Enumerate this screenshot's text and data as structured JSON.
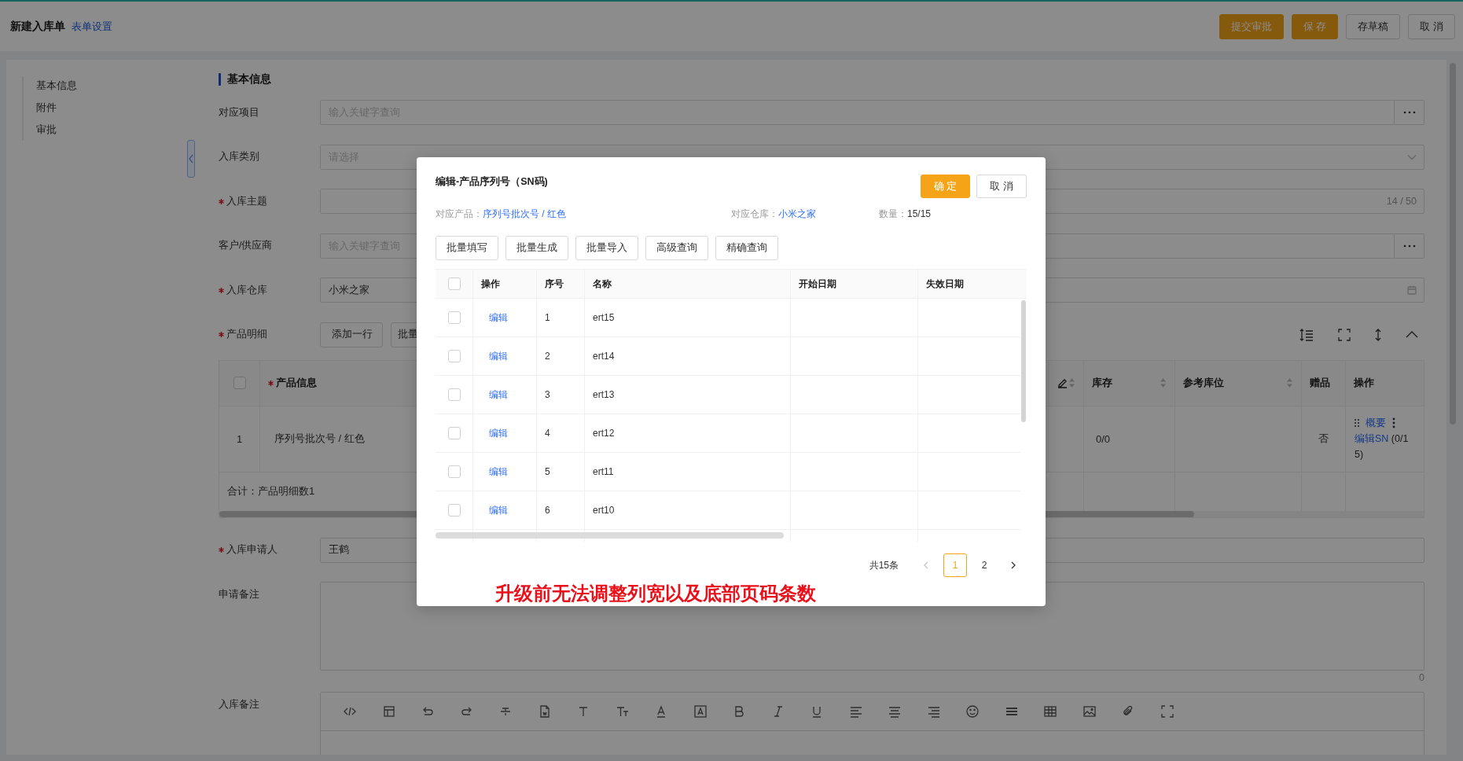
{
  "header": {
    "title": "新建入库单",
    "link": "表单设置",
    "buttons": [
      {
        "label": "提交审批",
        "kind": "primary"
      },
      {
        "label": "保 存",
        "kind": "primary"
      },
      {
        "label": "存草稿",
        "kind": "default"
      },
      {
        "label": "取 消",
        "kind": "default"
      }
    ]
  },
  "anchor_nav": [
    {
      "label": "基本信息"
    },
    {
      "label": "附件"
    },
    {
      "label": "审批"
    }
  ],
  "section_title": "基本信息",
  "form_rows": [
    {
      "label": "对应项目",
      "required": false,
      "kind": "lookup",
      "placeholder": "输入关键字查询"
    },
    {
      "label": "入库类别",
      "required": false,
      "kind": "select",
      "placeholder": "请选择"
    },
    {
      "label": "入库主题",
      "required": true,
      "kind": "counted",
      "counter": "14 / 50"
    },
    {
      "label": "客户/供应商",
      "required": false,
      "kind": "lookup",
      "placeholder": "输入关键字查询"
    },
    {
      "label": "入库仓库",
      "required": true,
      "kind": "date",
      "value": "小米之家"
    },
    {
      "label": "产品明细",
      "required": true,
      "kind": "actions",
      "buttons": [
        "添加一行",
        "批量"
      ]
    }
  ],
  "product_table": {
    "select_all": {
      "checked": false
    },
    "columns": [
      {
        "label": "产品信息",
        "required": true,
        "sortable": false
      },
      {
        "label": "库存",
        "required": false,
        "sortable": true
      },
      {
        "label": "参考库位",
        "required": false,
        "sortable": true
      },
      {
        "label": "赠品",
        "required": false,
        "sortable": false
      },
      {
        "label": "操作",
        "required": false,
        "sortable": false
      }
    ],
    "rows": [
      {
        "index": "1",
        "product": "序列号批次号 / 红色",
        "stock": "0/0",
        "gift": "否",
        "summary_link": "概要",
        "sn_link": "编辑SN",
        "sn_count": "(0/15)"
      }
    ],
    "footer": "合计：产品明细数1"
  },
  "lower_rows": [
    {
      "label": "入库申请人",
      "required": true,
      "kind": "text",
      "value": "王鹤"
    },
    {
      "label": "申请备注",
      "required": false,
      "kind": "textarea",
      "counter": "0"
    },
    {
      "label": "入库备注",
      "required": false,
      "kind": "editor"
    }
  ],
  "modal": {
    "title": "编辑-产品序列号（SN码)",
    "confirm": "确 定",
    "cancel": "取 消",
    "info": [
      {
        "label": "对应产品：",
        "value": "序列号批次号 / 红色",
        "kind": "link"
      },
      {
        "label": "对应仓库：",
        "value": "小米之家",
        "kind": "link"
      },
      {
        "label": "数量：",
        "value": "15/15",
        "kind": "plain"
      }
    ],
    "tools": [
      "批量填写",
      "批量生成",
      "批量导入",
      "高级查询",
      "精确查询"
    ],
    "select_all": {
      "checked": false
    },
    "columns": [
      "操作",
      "序号",
      "名称",
      "开始日期",
      "失效日期"
    ],
    "rows": [
      {
        "checked": false,
        "action": "编辑",
        "index": "1",
        "name": "ert15"
      },
      {
        "checked": false,
        "action": "编辑",
        "index": "2",
        "name": "ert14"
      },
      {
        "checked": false,
        "action": "编辑",
        "index": "3",
        "name": "ert13"
      },
      {
        "checked": false,
        "action": "编辑",
        "index": "4",
        "name": "ert12"
      },
      {
        "checked": false,
        "action": "编辑",
        "index": "5",
        "name": "ert11"
      },
      {
        "checked": false,
        "action": "编辑",
        "index": "6",
        "name": "ert10"
      }
    ],
    "pagination": {
      "total": "共15条",
      "prev_disabled": true,
      "next_disabled": false,
      "pages": [
        {
          "label": "1",
          "selected": true
        },
        {
          "label": "2",
          "selected": false
        }
      ]
    },
    "annotation": "升级前无法调整列宽以及底部页码条数"
  }
}
